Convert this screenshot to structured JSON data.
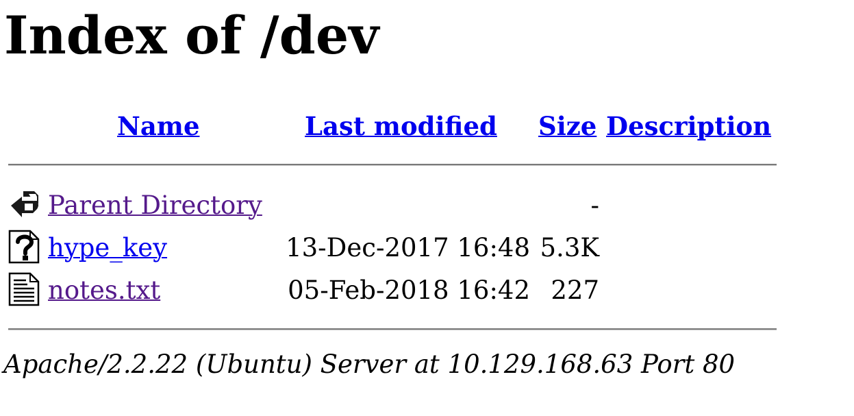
{
  "page": {
    "title": "Index of /dev"
  },
  "table": {
    "headers": {
      "name": "Name",
      "last_modified": "Last modified",
      "size": "Size",
      "description": "Description"
    },
    "rows": [
      {
        "name": "Parent Directory",
        "last_modified": "",
        "size": "-",
        "description": "",
        "icon": "back-arrow-icon",
        "visited": true
      },
      {
        "name": "hype_key",
        "last_modified": "13-Dec-2017 16:48",
        "size": "5.3K",
        "description": "",
        "icon": "unknown-file-icon",
        "visited": false
      },
      {
        "name": "notes.txt",
        "last_modified": "05-Feb-2018 16:42",
        "size": "227",
        "description": "",
        "icon": "text-file-icon",
        "visited": true
      }
    ]
  },
  "footer": {
    "server_signature": "Apache/2.2.22 (Ubuntu) Server at 10.129.168.63 Port 80"
  },
  "colors": {
    "link": "#0000ee",
    "visited_link": "#551a8b",
    "text": "#000000",
    "background": "#ffffff"
  }
}
